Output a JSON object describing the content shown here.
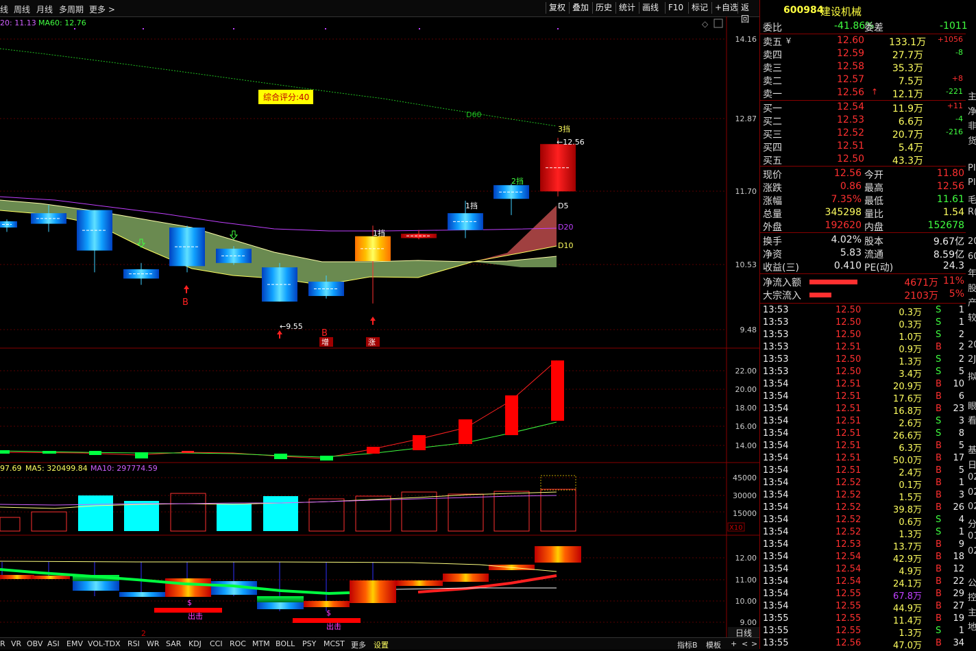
{
  "toolbar": {
    "left_tabs": [
      "线",
      "周线",
      "月线",
      "多周期",
      "更多 >"
    ],
    "right_buttons": [
      "复权",
      "叠加",
      "历史",
      "统计",
      "画线",
      "F10",
      "标记",
      "+自选",
      "返回"
    ]
  },
  "main_chart": {
    "ma_legend_prefix": "20: 11.13",
    "ma60_legend": "MA60: 12.76",
    "y_ticks": [
      "14.16",
      "12.87",
      "11.70",
      "10.53",
      "9.48"
    ],
    "score_badge": "综合评分:40",
    "labels": {
      "d60": "D60",
      "d5": "D5",
      "d20": "D20",
      "d10": "D10",
      "gear3": "3挡",
      "gear2": "2挡",
      "gear1a": "1挡",
      "gear1b": "1挡",
      "high_mark": "←12.56",
      "low_mark": "←9.55",
      "buy_b1": "B",
      "buy_b2": "B",
      "zeng": "增",
      "zhang": "涨"
    },
    "candles": [
      {
        "o": 11.22,
        "c": 11.12,
        "h": 11.25,
        "l": 11.05
      },
      {
        "o": 11.35,
        "c": 11.18,
        "h": 11.48,
        "l": 11.05
      },
      {
        "o": 11.4,
        "c": 10.75,
        "h": 11.4,
        "l": 10.4
      },
      {
        "o": 10.45,
        "c": 10.3,
        "h": 10.55,
        "l": 10.2
      },
      {
        "o": 11.12,
        "c": 10.5,
        "h": 11.15,
        "l": 10.4
      },
      {
        "o": 10.78,
        "c": 10.55,
        "h": 10.82,
        "l": 10.52
      },
      {
        "o": 10.48,
        "c": 9.93,
        "h": 10.55,
        "l": 9.93
      },
      {
        "o": 10.25,
        "c": 10.02,
        "h": 10.35,
        "l": 9.98
      },
      {
        "o": 10.58,
        "c": 10.98,
        "h": 11.15,
        "l": 9.9
      },
      {
        "o": 10.95,
        "c": 11.02,
        "h": 11.08,
        "l": 10.93
      },
      {
        "o": 11.35,
        "c": 11.08,
        "h": 11.55,
        "l": 10.95
      },
      {
        "o": 11.8,
        "c": 11.58,
        "h": 11.82,
        "l": 11.32
      },
      {
        "o": 11.7,
        "c": 12.46,
        "h": 12.56,
        "l": 11.62
      }
    ]
  },
  "sub1": {
    "y_ticks": [
      "22.00",
      "20.00",
      "18.00",
      "16.00",
      "14.00"
    ]
  },
  "volume": {
    "legend_a": "97.69",
    "legend_ma5": "MA5: 320499.84",
    "legend_ma10": "MA10: 297774.59",
    "y_ticks": [
      "45000",
      "30000",
      "15000"
    ],
    "unit": "X10"
  },
  "sub3": {
    "y_ticks": [
      "12.00",
      "11.00",
      "10.00",
      "9.00"
    ],
    "labels": {
      "dollar1": "$",
      "dollar2": "$",
      "out1": "出击",
      "out2": "出击"
    }
  },
  "bottom_bar": {
    "indicators": [
      "R",
      "VR",
      "OBV",
      "ASI",
      "EMV",
      "VOL-TDX",
      "RSI",
      "WR",
      "SAR",
      "KDJ",
      "CCI",
      "ROC",
      "MTM",
      "BOLL",
      "PSY",
      "MCST",
      "更多",
      "设置"
    ],
    "right": [
      "指标B",
      "模板",
      "+",
      "<",
      ">"
    ]
  },
  "quote": {
    "code": "600984",
    "name": "建设机械",
    "webi_label": "委比",
    "webi_value": "-41.86%",
    "wecha_label": "委差",
    "wecha_value": "-1011",
    "asks": [
      {
        "label": "卖五",
        "mark": "￥",
        "price": "12.60",
        "vol": "133.1万",
        "chg": "+1056"
      },
      {
        "label": "卖四",
        "mark": "",
        "price": "12.59",
        "vol": "27.7万",
        "chg": "-8"
      },
      {
        "label": "卖三",
        "mark": "",
        "price": "12.58",
        "vol": "35.3万",
        "chg": ""
      },
      {
        "label": "卖二",
        "mark": "",
        "price": "12.57",
        "vol": "7.5万",
        "chg": "+8"
      },
      {
        "label": "卖一",
        "mark": "",
        "price": "12.56",
        "vol": "12.1万",
        "chg": "-221"
      }
    ],
    "bids": [
      {
        "label": "买一",
        "price": "12.54",
        "vol": "11.9万",
        "chg": "+11"
      },
      {
        "label": "买二",
        "price": "12.53",
        "vol": "6.6万",
        "chg": "-4"
      },
      {
        "label": "买三",
        "price": "12.52",
        "vol": "20.7万",
        "chg": "-216"
      },
      {
        "label": "买四",
        "price": "12.51",
        "vol": "5.4万",
        "chg": ""
      },
      {
        "label": "买五",
        "price": "12.50",
        "vol": "43.3万",
        "chg": ""
      }
    ],
    "stats": [
      {
        "l1": "现价",
        "v1": "12.56",
        "l2": "今开",
        "v2": "11.80"
      },
      {
        "l1": "涨跌",
        "v1": "0.86",
        "l2": "最高",
        "v2": "12.56"
      },
      {
        "l1": "涨幅",
        "v1": "7.35%",
        "l2": "最低",
        "v2": "11.61"
      },
      {
        "l1": "总量",
        "v1": "345298",
        "l2": "量比",
        "v2": "1.54"
      },
      {
        "l1": "外盘",
        "v1": "192620",
        "l2": "内盘",
        "v2": "152678"
      }
    ],
    "stats2": [
      {
        "l1": "换手",
        "v1": "4.02%",
        "l2": "股本",
        "v2": "9.67亿"
      },
      {
        "l1": "净资",
        "v1": "5.83",
        "l2": "流通",
        "v2": "8.59亿"
      },
      {
        "l1": "收益(三)",
        "v1": "0.410",
        "l2": "PE(动)",
        "v2": "24.3"
      }
    ],
    "flows": [
      {
        "label": "净流入额",
        "value": "4671万",
        "pct": "11%",
        "bar": 0.11
      },
      {
        "label": "大宗流入",
        "value": "2103万",
        "pct": "5%",
        "bar": 0.05
      }
    ]
  },
  "ticks": [
    [
      "13:53",
      "12.50",
      "0.3万",
      "S",
      "1"
    ],
    [
      "13:53",
      "12.50",
      "0.3万",
      "S",
      "1"
    ],
    [
      "13:53",
      "12.50",
      "1.0万",
      "S",
      "2"
    ],
    [
      "13:53",
      "12.51",
      "0.9万",
      "B",
      "2"
    ],
    [
      "13:53",
      "12.50",
      "1.3万",
      "S",
      "2"
    ],
    [
      "13:53",
      "12.50",
      "3.4万",
      "S",
      "5"
    ],
    [
      "13:54",
      "12.51",
      "20.9万",
      "B",
      "10"
    ],
    [
      "13:54",
      "12.51",
      "17.6万",
      "B",
      "6"
    ],
    [
      "13:54",
      "12.51",
      "16.8万",
      "B",
      "23"
    ],
    [
      "13:54",
      "12.51",
      "2.6万",
      "S",
      "3"
    ],
    [
      "13:54",
      "12.51",
      "26.6万",
      "S",
      "8"
    ],
    [
      "13:54",
      "12.51",
      "6.3万",
      "B",
      "5"
    ],
    [
      "13:54",
      "12.51",
      "50.0万",
      "B",
      "17"
    ],
    [
      "13:54",
      "12.51",
      "2.4万",
      "B",
      "5"
    ],
    [
      "13:54",
      "12.52",
      "0.1万",
      "B",
      "1"
    ],
    [
      "13:54",
      "12.52",
      "1.5万",
      "B",
      "3"
    ],
    [
      "13:54",
      "12.52",
      "39.8万",
      "B",
      "26"
    ],
    [
      "13:54",
      "12.52",
      "0.6万",
      "S",
      "4"
    ],
    [
      "13:54",
      "12.52",
      "1.3万",
      "S",
      "1"
    ],
    [
      "13:54",
      "12.53",
      "13.7万",
      "B",
      "9"
    ],
    [
      "13:54",
      "12.54",
      "42.9万",
      "B",
      "18"
    ],
    [
      "13:54",
      "12.54",
      "4.9万",
      "B",
      "12"
    ],
    [
      "13:54",
      "12.54",
      "24.1万",
      "B",
      "22"
    ],
    [
      "13:54",
      "12.55",
      "67.8万",
      "B",
      "29"
    ],
    [
      "13:54",
      "12.55",
      "44.9万",
      "B",
      "27"
    ],
    [
      "13:55",
      "12.55",
      "11.4万",
      "B",
      "19"
    ],
    [
      "13:55",
      "12.55",
      "1.3万",
      "S",
      "1"
    ],
    [
      "13:55",
      "12.56",
      "47.0万",
      "B",
      "34"
    ]
  ],
  "edge_chars": [
    "主",
    "净",
    "非",
    "货",
    "",
    "PI",
    "PI",
    "毛",
    "R(",
    "",
    "20",
    "60",
    "年",
    "股",
    "产",
    "较",
    "",
    "20",
    "2J",
    "拟",
    "",
    "眼",
    "看",
    "",
    "基",
    "日",
    "02",
    "02",
    "02",
    "分",
    "01",
    "02",
    "",
    "公",
    "控",
    "主",
    "地"
  ],
  "period_label": "日线"
}
